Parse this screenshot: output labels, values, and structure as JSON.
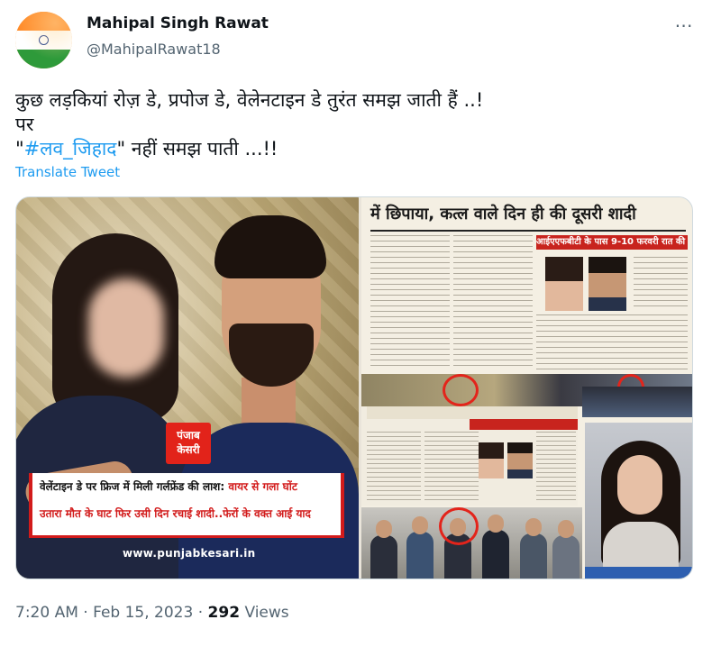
{
  "author": {
    "display_name": "Mahipal Singh Rawat",
    "handle": "@MahipalRawat18",
    "avatar": "india-flag-avatar"
  },
  "more_icon": "⋯",
  "tweet": {
    "line1": "कुछ लड़कियां रोज़ डे, प्रपोज डे, वेलेनटाइन डे तुरंत समझ जाती हैं ..!",
    "line2": "पर",
    "line3_open_quote": "\"",
    "hashtag": "#लव_जिहाद",
    "line3_rest": "\" नहीं समझ पाती ...!!",
    "translate_label": "Translate Tweet"
  },
  "media": {
    "logo_line1": "पंजाब",
    "logo_line2": "केसरी",
    "headline_part1": "वेलेंटाइन डे पर फ्रिज में मिली गर्लफ्रेंड की लाश:",
    "headline_part2": " वायर से गला घोंट",
    "headline_line2": "उतारा मौत के घाट फिर उसी दिन रचाई शादी..फेरों के वक्त आई याद",
    "url": "www.punjabkesari.in",
    "newspaper_headline": "में छिपाया, कत्ल वाले दिन ही की दूसरी शादी",
    "newspaper_redbar": "आईएएफबीटी के पास 9-10 फरवरी रात की घटना"
  },
  "meta": {
    "time": "7:20 AM",
    "separator": " · ",
    "date": "Feb 15, 2023",
    "views_count": "292",
    "views_label": " Views"
  },
  "colors": {
    "link": "#1d9bf0",
    "secondary_text": "#536471",
    "primary_text": "#0f1419",
    "headline_red": "#d21b1b"
  }
}
